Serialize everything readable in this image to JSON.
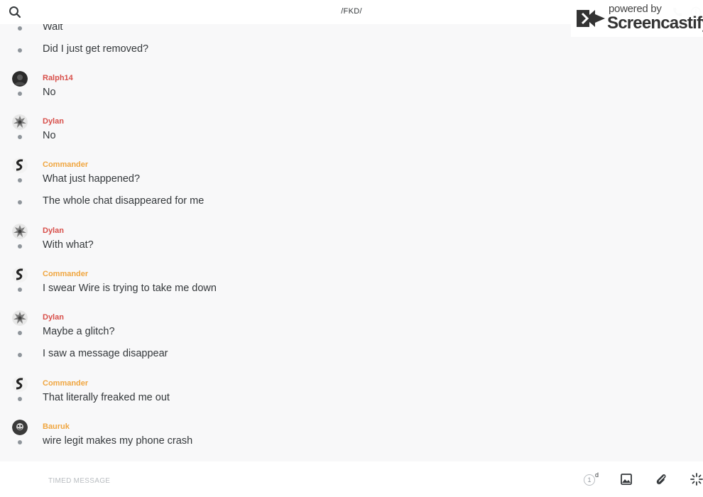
{
  "header": {
    "title": "/FKD/",
    "search_icon": "search-icon",
    "call_icon": "phone-icon",
    "info_icon": "info-icon"
  },
  "watermark": {
    "powered": "powered by",
    "brand": "Screencastify"
  },
  "colors": {
    "sender_red": "#d84f4a",
    "sender_orange": "#f0a640",
    "text": "#34383b",
    "dot": "#8f959b",
    "background": "#f8f8f9"
  },
  "messages": [
    {
      "lines": [
        "Wait",
        "Did I just get removed?"
      ]
    },
    {
      "sender": "Ralph14",
      "lines": [
        "No"
      ]
    },
    {
      "sender": "Dylan",
      "lines": [
        "No"
      ]
    },
    {
      "sender": "Commander",
      "lines": [
        "What just happened?",
        "The whole chat disappeared for me"
      ]
    },
    {
      "sender": "Dylan",
      "lines": [
        "With what?"
      ]
    },
    {
      "sender": "Commander",
      "lines": [
        "I swear Wire is trying to take me down"
      ]
    },
    {
      "sender": "Dylan",
      "lines": [
        "Maybe a glitch?",
        "I saw a message disappear"
      ]
    },
    {
      "sender": "Commander",
      "lines": [
        "That literally freaked me out"
      ]
    },
    {
      "sender": "Bauruk",
      "lines": [
        "wire legit makes my phone crash"
      ]
    }
  ],
  "composer": {
    "placeholder": "TIMED MESSAGE",
    "timer_value": "1",
    "timer_unit": "d",
    "image_icon": "image-icon",
    "attach_icon": "paperclip-icon",
    "more_icon": "sparkle-icon"
  }
}
